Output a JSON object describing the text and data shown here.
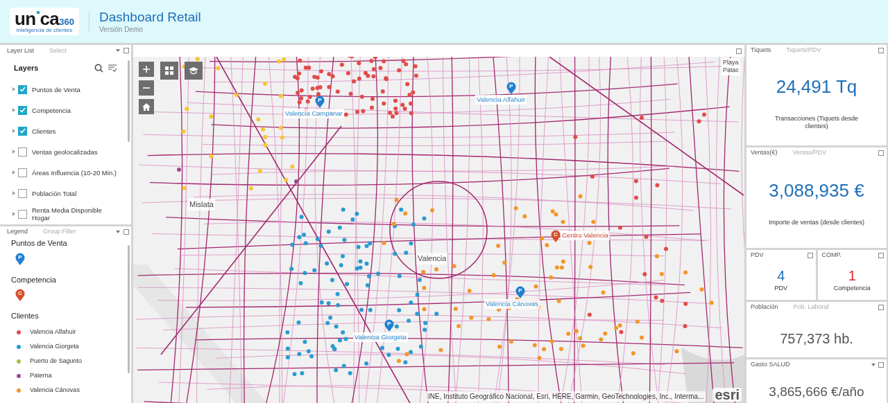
{
  "header": {
    "logo_text": "un",
    "logo_text_2": "ca",
    "logo_suffix": "360",
    "logo_tagline": "inteligencia de clientes",
    "title": "Dashboard Retail",
    "subtitle": "Versión Demo"
  },
  "layer_panel": {
    "tabs": [
      {
        "label": "Layer List",
        "selected": true
      },
      {
        "label": "Select",
        "selected": false
      }
    ],
    "heading": "Layers",
    "layers": [
      {
        "label": "Puntos de Venta",
        "checked": true
      },
      {
        "label": "Competencia",
        "checked": true
      },
      {
        "label": "Clientes",
        "checked": true
      },
      {
        "label": "Ventas geolocalizadas",
        "checked": false
      },
      {
        "label": "Áreas Influencia (10-20 Min.)",
        "checked": false
      },
      {
        "label": "Población Total",
        "checked": false
      },
      {
        "label": "Renta Media Disponible Hogar",
        "checked": false
      }
    ]
  },
  "legend_panel": {
    "tabs": [
      {
        "label": "Legend",
        "selected": true
      },
      {
        "label": "Group Filter",
        "selected": false
      }
    ],
    "groups": [
      {
        "title": "Puntos de Venta",
        "kind": "pin",
        "symbol": "P"
      },
      {
        "title": "Competencia",
        "kind": "pin-competitor",
        "symbol": "C"
      },
      {
        "title": "Clientes",
        "kind": "dots",
        "items": [
          {
            "label": "Valencia Alfahuir",
            "color": "#e14b4b"
          },
          {
            "label": "Valencia Giorgeta",
            "color": "#2a9bd0"
          },
          {
            "label": "Puerto de Sagunto",
            "color": "#9cc43a"
          },
          {
            "label": "Paterna",
            "color": "#9a4b93"
          },
          {
            "label": "Valencia Cánovas",
            "color": "#f2962b"
          }
        ]
      }
    ]
  },
  "map": {
    "markers": [
      {
        "label": "Valencia Campanar",
        "kind": "store",
        "symbol": "P"
      },
      {
        "label": "Valencia Alfahuir",
        "kind": "store",
        "symbol": "P"
      },
      {
        "label": "Valencia Cánovas",
        "kind": "store",
        "symbol": "P"
      },
      {
        "label": "Valencia Giorgeta",
        "kind": "store",
        "symbol": "P"
      },
      {
        "label": "Centro Valencia",
        "kind": "competitor",
        "symbol": "C"
      }
    ],
    "places": [
      "Mislata",
      "Valencia",
      "Playa",
      "Patac"
    ],
    "attribution": "INE, Instituto Geográfico Nacional, Esri, HERE, Garmin, GeoTechnologies, Inc., Interma...",
    "logo": "esri"
  },
  "cards": [
    {
      "title": "Tiquets",
      "tab": "Tiquets/PDV",
      "value": "24,491 Tq",
      "caption": "Transacciones (Tiquets desde clientes)",
      "color": "#1f6fb8",
      "menu": false
    },
    {
      "title": "Ventas(€)",
      "tab": "Ventas/PDV",
      "value": "3,088,935 €",
      "caption": "Importe de ventas (desde clientes)",
      "color": "#1f6fb8",
      "menu": false
    },
    {
      "title": "PDV",
      "value": "4",
      "caption": "PDV",
      "color": "#1f6fb8",
      "menu": false
    },
    {
      "title": "COMP.",
      "value": "1",
      "caption": "Competencia",
      "color": "#e02020",
      "menu": false
    },
    {
      "title": "Población",
      "tab": "Pob. Laboral",
      "value": "757,373 hb.",
      "color": "#555555",
      "menu": false
    },
    {
      "title": "Gasto SALUD",
      "value": "3,865,666 €/año",
      "color": "#555555",
      "menu": true
    }
  ]
}
